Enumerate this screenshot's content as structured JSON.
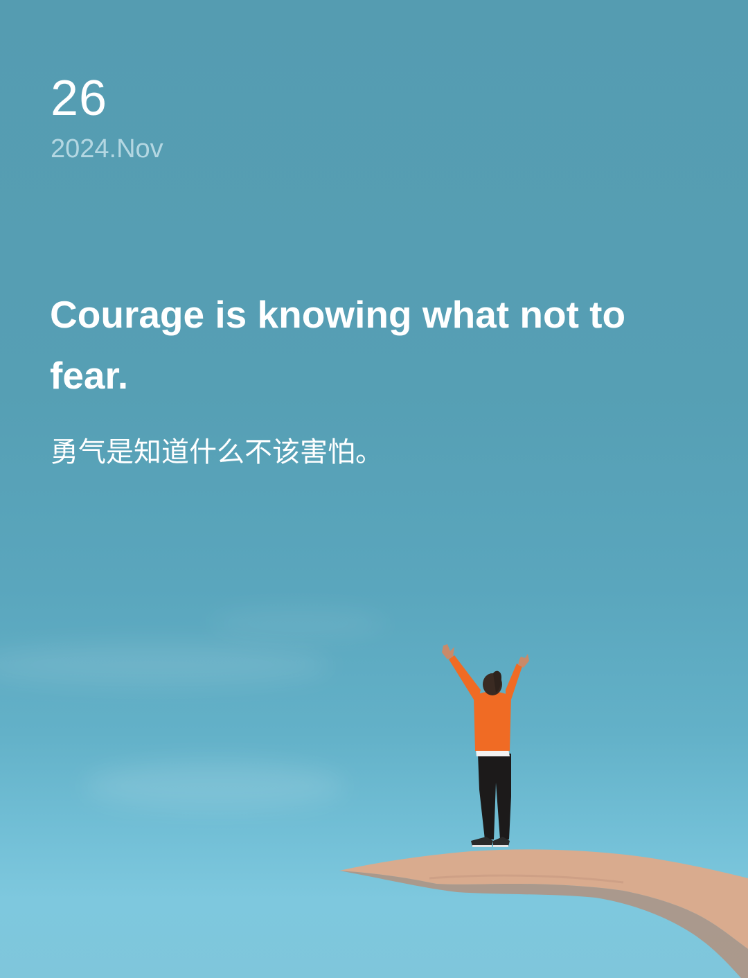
{
  "date": {
    "day": "26",
    "year_month": "2024.Nov"
  },
  "quote": {
    "english": "Courage is knowing what not to fear.",
    "chinese": "勇气是知道什么不该害怕。"
  },
  "colors": {
    "sky_top": "#559cb1",
    "sky_bottom": "#7fc6db",
    "text_primary": "#ffffff",
    "text_muted": "#b4d7e2",
    "jacket": "#f06b24",
    "leggings": "#1c1a1a",
    "rock": "#d6a98c"
  },
  "background": {
    "scene": "person-with-raised-arms-on-rock-ledge"
  }
}
